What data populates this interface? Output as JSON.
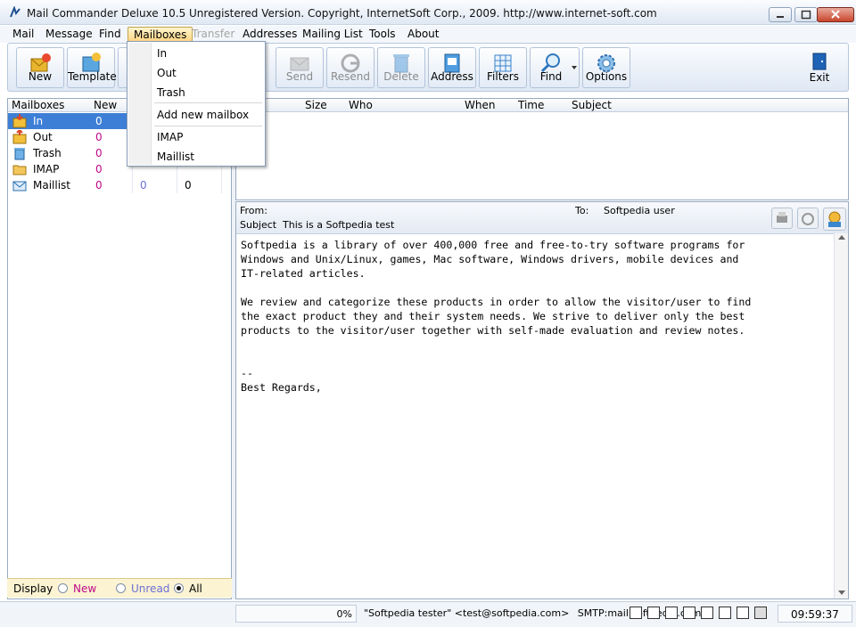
{
  "window": {
    "title": "Mail Commander Deluxe 10.5 Unregistered Version. Copyright, InternetSoft Corp., 2009. http://www.internet-soft.com"
  },
  "menubar": {
    "items": [
      "Mail",
      "Message",
      "Find",
      "Mailboxes",
      "Transfer",
      "Addresses",
      "Mailing List",
      "Tools",
      "About"
    ]
  },
  "dropdown": {
    "items": [
      "In",
      "Out",
      "Trash",
      "Add new mailbox",
      "IMAP",
      "Maillist"
    ]
  },
  "toolbar": {
    "buttons": [
      "New",
      "Template",
      "Send",
      "Resend",
      "Delete",
      "Address",
      "Filters",
      "Find",
      "Options",
      "Exit"
    ]
  },
  "mailboxes": {
    "headers": [
      "Mailboxes",
      "New"
    ],
    "rows": [
      {
        "name": "In",
        "new": "0"
      },
      {
        "name": "Out",
        "new": "0"
      },
      {
        "name": "Trash",
        "new": "0"
      },
      {
        "name": "IMAP",
        "new": "0"
      },
      {
        "name": "Maillist",
        "new": "0",
        "c2": "0",
        "c3": "0"
      }
    ]
  },
  "display": {
    "label": "Display",
    "options": [
      "New",
      "Unread",
      "All"
    ],
    "selected": "All"
  },
  "msglist": {
    "headers": [
      "Size",
      "Who",
      "When",
      "Time",
      "Subject"
    ]
  },
  "preview": {
    "from_label": "From:",
    "to_label": "To:",
    "to_value": "Softpedia user",
    "subject_label": "Subject",
    "subject_value": "This is a Softpedia test",
    "body": "Softpedia is a library of over 400,000 free and free-to-try software programs for\nWindows and Unix/Linux, games, Mac software, Windows drivers, mobile devices and\nIT-related articles.\n\nWe review and categorize these products in order to allow the visitor/user to find\nthe exact product they and their system needs. We strive to deliver only the best\nproducts to the visitor/user together with self-made evaluation and review notes.\n\n\n--\nBest Regards,"
  },
  "status": {
    "percent": "0%",
    "sender": "\"Softpedia tester\" <test@softpedia.com>",
    "smtp": "SMTP:mail.softpedia.com",
    "time": "09:59:37"
  },
  "colors": {
    "accent": "#3d7fd6",
    "selected_row": "#3d7fd6",
    "count_magenta": "#c0098a",
    "count_blue": "#6b6fd6"
  }
}
